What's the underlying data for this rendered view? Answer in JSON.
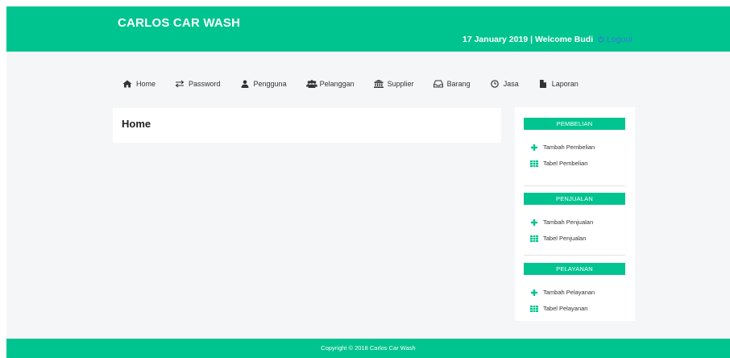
{
  "header": {
    "brand": "CARLOS CAR WASH",
    "date": "17 January 2019",
    "separator": "|",
    "welcome": "Welcome Budi",
    "logout_label": "Logout"
  },
  "nav": {
    "items": [
      {
        "label": "Home",
        "icon": "home-icon"
      },
      {
        "label": "Password",
        "icon": "exchange-arrows-icon"
      },
      {
        "label": "Pengguna",
        "icon": "user-icon"
      },
      {
        "label": "Pelanggan",
        "icon": "users-icon"
      },
      {
        "label": "Supplier",
        "icon": "bank-icon"
      },
      {
        "label": "Barang",
        "icon": "inbox-icon"
      },
      {
        "label": "Jasa",
        "icon": "clock-icon"
      },
      {
        "label": "Laporan",
        "icon": "file-icon"
      }
    ]
  },
  "main": {
    "title": "Home"
  },
  "sidebar": {
    "sections": [
      {
        "title": "PEMBELIAN",
        "links": [
          {
            "label": "Tambah Pembelian",
            "icon": "plus-icon"
          },
          {
            "label": "Tabel Pembelian",
            "icon": "table-icon"
          }
        ]
      },
      {
        "title": "PENJUALAN",
        "links": [
          {
            "label": "Tambah Penjualan",
            "icon": "plus-icon"
          },
          {
            "label": "Tabel Penjualan",
            "icon": "table-icon"
          }
        ]
      },
      {
        "title": "PELAYANAN",
        "links": [
          {
            "label": "Tambah Pelayanan",
            "icon": "plus-icon"
          },
          {
            "label": "Tabel Pelayanan",
            "icon": "table-icon"
          }
        ]
      }
    ]
  },
  "footer": {
    "copyright": "Copyright © 2018 Carlos Car Wash"
  },
  "colors": {
    "accent": "#00c48f",
    "background": "#f5f6f8",
    "link_blue": "#2f7ed8"
  }
}
